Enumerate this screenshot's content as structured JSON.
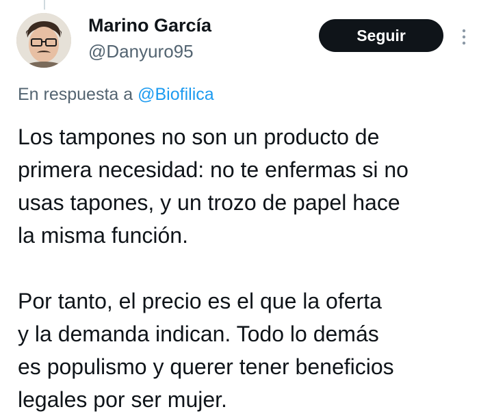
{
  "tweet": {
    "author": {
      "display_name": "Marino García",
      "handle": "@Danyuro95",
      "avatar_icon": "user-avatar-photo"
    },
    "follow_label": "Seguir",
    "more_icon": "more-vertical-icon",
    "reply_prefix": "En respuesta a",
    "reply_to": "@Biofilica",
    "paragraphs": [
      "Los tampones no son un producto de\nprimera necesidad: no te enfermas si no\nusas tapones, y un trozo de papel hace\nla misma función.",
      "Por tanto, el precio es el que la oferta\ny la demanda indican. Todo lo demás\nes populismo y querer tener beneficios\nlegales por ser mujer."
    ]
  },
  "colors": {
    "text": "#0f1419",
    "secondary_text": "#536471",
    "link": "#1d9bf0",
    "button_bg": "#0f1419",
    "button_text": "#ffffff",
    "thread_line": "#cfd9de"
  }
}
